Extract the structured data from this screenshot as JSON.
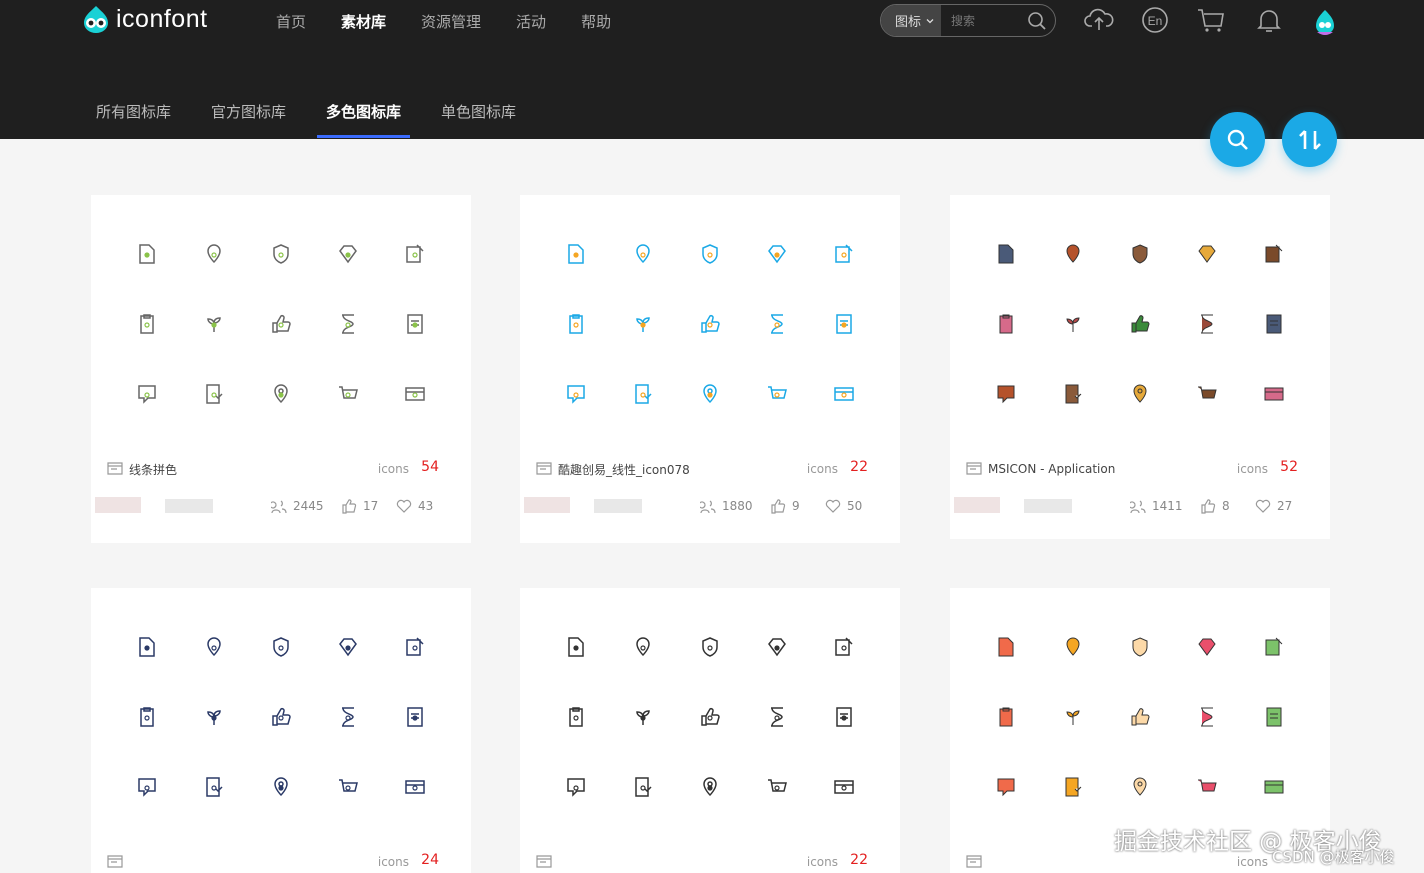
{
  "brand": {
    "name": "iconfont",
    "colors": {
      "header_bg": "#1f1f1f",
      "accent": "#3b6cff",
      "float": "#1ba9e6",
      "count": "#e32020"
    }
  },
  "nav": [
    "首页",
    "素材库",
    "资源管理",
    "活动",
    "帮助"
  ],
  "search": {
    "type": "图标",
    "placeholder": "搜索"
  },
  "top_icons": [
    "upload-cloud-icon",
    "language-en-icon",
    "cart-icon",
    "bell-icon",
    "user-avatar-icon"
  ],
  "subnav": [
    "所有图标库",
    "官方图标库",
    "多色图标库",
    "单色图标库"
  ],
  "float_buttons": [
    "search-icon",
    "sort-icon"
  ],
  "cards": [
    {
      "name": "线条拼色",
      "icons_label": "icons",
      "count": "54",
      "views": "2445",
      "likes": "17",
      "favs": "43",
      "style": "outline-mix"
    },
    {
      "name": "酷趣创易_线性_icon078",
      "icons_label": "icons",
      "count": "22",
      "views": "1880",
      "likes": "9",
      "favs": "50",
      "style": "cyan-orange"
    },
    {
      "name": "MSICON - Application",
      "icons_label": "icons",
      "count": "52",
      "views": "1411",
      "likes": "8",
      "favs": "27",
      "style": "filled-color"
    },
    {
      "name": "",
      "icons_label": "icons",
      "count": "24",
      "style": "navy-outline"
    },
    {
      "name": "",
      "icons_label": "icons",
      "count": "22",
      "style": "dark-outline"
    },
    {
      "name": "",
      "icons_label": "icons",
      "count": "",
      "style": "food-color"
    }
  ],
  "watermark": {
    "line1": "掘金技术社区 @ 极客小俊",
    "line2": "CSDN @极客小俊"
  }
}
